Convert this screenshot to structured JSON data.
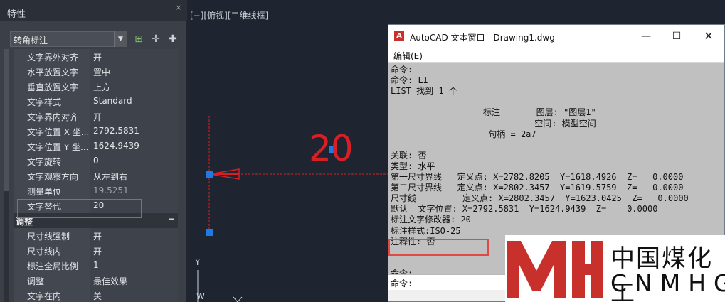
{
  "palette": {
    "title": "特性",
    "close_glyph": "×",
    "selector_value": "转角标注",
    "icons": [
      "quick-select-icon",
      "select-objects-icon",
      "pickadd-icon"
    ],
    "properties_top": [
      {
        "name": "文字界外对齐",
        "value": "开"
      },
      {
        "name": "水平放置文字",
        "value": "置中"
      },
      {
        "name": "垂直放置文字",
        "value": "上方"
      },
      {
        "name": "文字样式",
        "value": "Standard"
      },
      {
        "name": "文字界内对齐",
        "value": "开"
      },
      {
        "name": "文字位置 X 坐...",
        "value": "2792.5831"
      },
      {
        "name": "文字位置 Y 坐...",
        "value": "1624.9439"
      },
      {
        "name": "文字旋转",
        "value": "0"
      },
      {
        "name": "文字观察方向",
        "value": "从左到右"
      },
      {
        "name": "测量单位",
        "value": "19.5251"
      },
      {
        "name": "文字替代",
        "value": "20"
      }
    ],
    "section_adjust": {
      "label": "调整",
      "toggle": "−"
    },
    "properties_adjust": [
      {
        "name": "尺寸线强制",
        "value": "开"
      },
      {
        "name": "尺寸线内",
        "value": "开"
      },
      {
        "name": "标注全局比例",
        "value": "1"
      },
      {
        "name": "调整",
        "value": "最佳效果"
      },
      {
        "name": "文字在内",
        "value": "关"
      }
    ]
  },
  "viewport": {
    "label": "[−][俯视][二维线框]",
    "dimension_text": "20",
    "ucs_y": "Y",
    "ucs_w": "W",
    "colors": {
      "dimension": "#d81f26",
      "grip": "#1e7be3",
      "background": "#1e2530"
    }
  },
  "text_window": {
    "title": "AutoCAD 文本窗口 - Drawing1.dwg",
    "app_icon": "autocad-icon",
    "menu_edit": "编辑(E)",
    "lines": [
      "命令:",
      "命令: LI",
      "LIST 找到 1 个",
      "",
      "                  标注       图层: \"图层1\"",
      "                            空间: 模型空间",
      "                   句柄 = 2a7",
      "",
      "关联: 否",
      "类型: 水平",
      "第一尺寸界线   定义点: X=2782.8205  Y=1618.4926  Z=   0.0000",
      "第二尺寸界线   定义点: X=2802.3457  Y=1619.5759  Z=   0.0000",
      "尺寸线         定义点: X=2802.3457  Y=1623.0425  Z=   0.0000",
      "默认  文字位置: X=2792.5831  Y=1624.9439  Z=    0.0000",
      "标注文字修改器: 20",
      "标注样式:ISO-25",
      "注释性: 否",
      "",
      "",
      "命令:"
    ],
    "prompt": "命令:"
  },
  "watermark": {
    "cn": "中国煤化工",
    "en": "CNMHG",
    "logo": "MH"
  }
}
